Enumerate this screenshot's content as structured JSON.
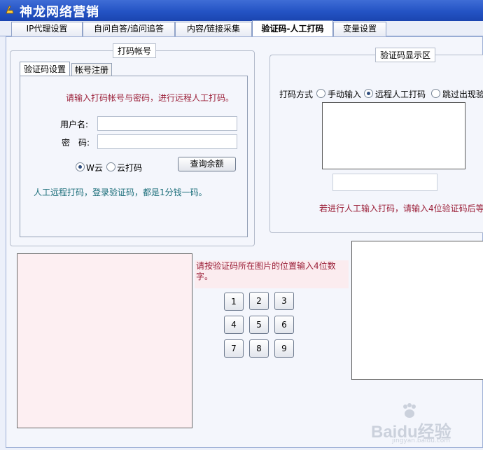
{
  "window": {
    "title": "神龙网络营销"
  },
  "tabs": [
    {
      "label": "IP代理设置"
    },
    {
      "label": "自问自答/追问追答"
    },
    {
      "label": "内容/链接采集"
    },
    {
      "label": "验证码-人工打码"
    },
    {
      "label": "变量设置"
    }
  ],
  "account_group": {
    "caption": "打码帐号",
    "subtabs": [
      {
        "label": "验证码设置"
      },
      {
        "label": "帐号注册"
      }
    ],
    "instruction": "请输入打码帐号与密码，进行远程人工打码。",
    "username_label": "用户名:",
    "username_value": "",
    "password_label": "密　码:",
    "password_value": "",
    "radio_w_label": "W云",
    "radio_cloud_label": "云打码",
    "selected_provider": "W云",
    "query_balance_button": "查询余额",
    "note": "人工远程打码，登录验证码，都是1分钱一码。"
  },
  "captcha_display": {
    "caption": "验证码显示区",
    "mode_label": "打码方式",
    "options": [
      {
        "label": "手动输入"
      },
      {
        "label": "远程人工打码"
      },
      {
        "label": "跳过出现验"
      }
    ],
    "selected_option": "远程人工打码",
    "code_input_value": "",
    "hint": "若进行人工输入打码，请输入4位验证码后等"
  },
  "position_pad": {
    "instruction": "请按验证码所在图片的位置输入4位数字。",
    "keys": [
      "1",
      "2",
      "3",
      "4",
      "5",
      "6",
      "7",
      "8",
      "9"
    ]
  },
  "watermark": {
    "text": "Baidu经验",
    "sub": "jingyan.baidu.com"
  },
  "colors": {
    "titlebar": "#2453c4",
    "panel_bg": "#f4f6fc",
    "red_text": "#9b1f38",
    "teal_text": "#1b6e7a",
    "pink_area": "#fdeff2"
  }
}
